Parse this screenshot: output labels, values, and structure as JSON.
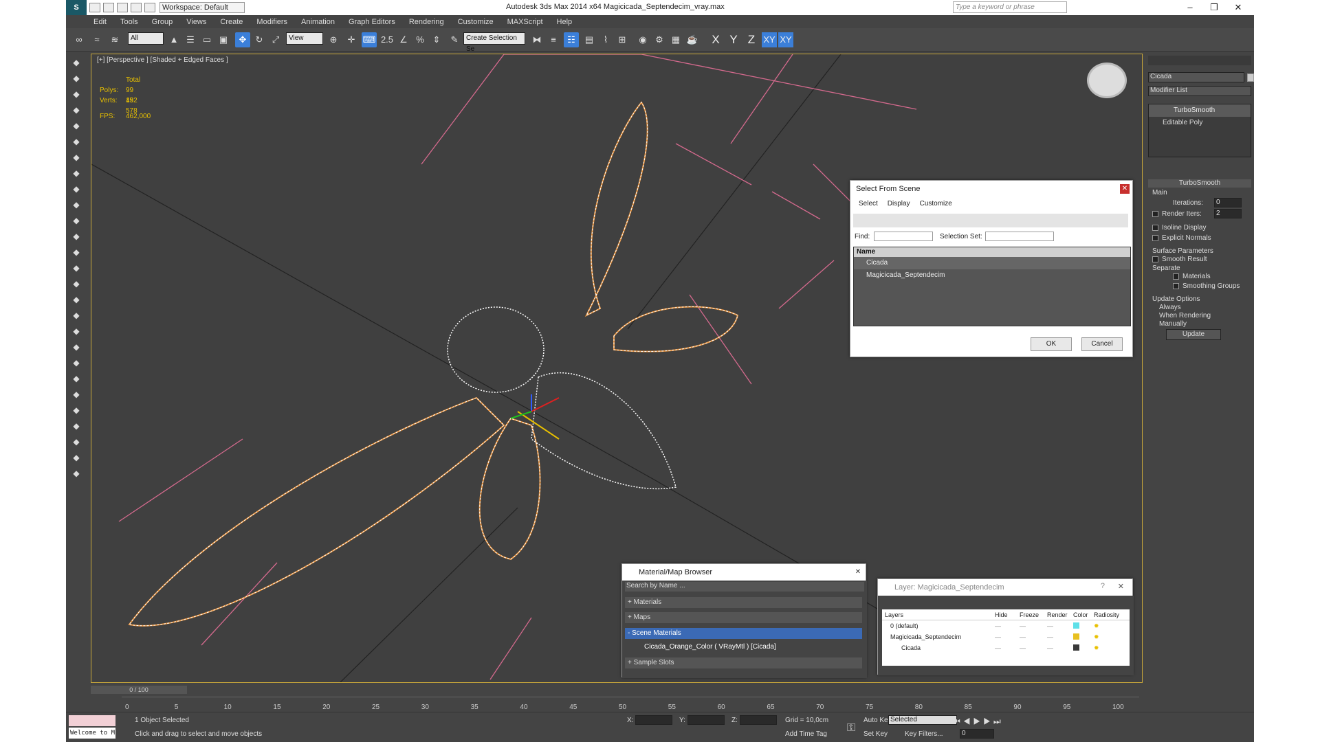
{
  "titlebar": {
    "logo": "S",
    "workspace": "Workspace: Default",
    "title": "Autodesk 3ds Max  2014 x64      Magicicada_Septendecim_vray.max",
    "search_placeholder": "Type a keyword or phrase",
    "minimize": "–",
    "maximize": "❐",
    "close": "✕"
  },
  "menu": [
    "Edit",
    "Tools",
    "Group",
    "Views",
    "Create",
    "Modifiers",
    "Animation",
    "Graph Editors",
    "Rendering",
    "Customize",
    "MAXScript",
    "Help"
  ],
  "toolbar": {
    "filter": "All",
    "refcoord": "View",
    "selset": "Create Selection Se",
    "snap_label": "2.5",
    "percent_label": "%",
    "axes": [
      "X",
      "Y",
      "Z",
      "XY",
      "XY"
    ]
  },
  "viewport": {
    "label": "[+] [Perspective ] [Shaded + Edged Faces ]",
    "stats": {
      "total_label": "Total",
      "polys_label": "Polys:",
      "polys": "99 152",
      "verts_label": "Verts:",
      "verts": "49 578",
      "fps_label": "FPS:",
      "fps": "462,000"
    }
  },
  "select_dialog": {
    "title": "Select From Scene",
    "menu": [
      "Select",
      "Display",
      "Customize"
    ],
    "find_label": "Find:",
    "selset_label": "Selection Set:",
    "col_name": "Name",
    "items": [
      "Cicada",
      "Magicicada_Septendecim"
    ],
    "ok": "OK",
    "cancel": "Cancel"
  },
  "material_browser": {
    "title": "Material/Map Browser",
    "search": "Search by Name ...",
    "sections": [
      "+ Materials",
      "+ Maps",
      "- Scene Materials"
    ],
    "material": "Cicada_Orange_Color  ( VRayMtl ) [Cicada]",
    "sample": "+ Sample Slots"
  },
  "layer_dialog": {
    "title": "Layer: Magicicada_Septendecim",
    "help": "?",
    "close": "✕",
    "cols": [
      "Layers",
      "Hide",
      "Freeze",
      "Render",
      "Color",
      "Radiosity"
    ],
    "rows": [
      {
        "name": "0 (default)",
        "color": "#5ee0e8"
      },
      {
        "name": "Magicicada_Septendecim",
        "color": "#e8c020"
      },
      {
        "name": "Cicada",
        "color": "#3a3a3a"
      }
    ]
  },
  "command_panel": {
    "object_name": "Cicada",
    "modifier_list": "Modifier List",
    "stack": [
      "TurboSmooth",
      "Editable Poly"
    ],
    "rollout": "TurboSmooth",
    "main": "Main",
    "iterations_label": "Iterations:",
    "iterations": "0",
    "render_iters_label": "Render Iters:",
    "render_iters": "2",
    "isoline": "Isoline Display",
    "explicit": "Explicit Normals",
    "surface": "Surface Parameters",
    "smooth_result": "Smooth Result",
    "separate": "Separate",
    "materials": "Materials",
    "smoothing": "Smoothing Groups",
    "update_options": "Update Options",
    "always": "Always",
    "when_rendering": "When Rendering",
    "manually": "Manually",
    "update": "Update"
  },
  "timeline": {
    "frame": "0 / 100",
    "ticks": [
      "0",
      "5",
      "10",
      "15",
      "20",
      "25",
      "30",
      "35",
      "40",
      "45",
      "50",
      "55",
      "60",
      "65",
      "70",
      "75",
      "80",
      "85",
      "90",
      "95",
      "100"
    ]
  },
  "status": {
    "maxscript": "Welcome to M",
    "selected": "1 Object Selected",
    "prompt": "Click and drag to select and move objects",
    "x_label": "X:",
    "y_label": "Y:",
    "z_label": "Z:",
    "grid": "Grid = 10,0cm",
    "add_time_tag": "Add Time Tag",
    "auto_key": "Auto Key",
    "set_key": "Set Key",
    "sel_mode": "Selected",
    "key_filters": "Key Filters...",
    "frame_field": "0"
  },
  "colors": {
    "accent": "#3b7fd9",
    "yellow": "#e8c000",
    "wire_orange": "#e8913a"
  }
}
